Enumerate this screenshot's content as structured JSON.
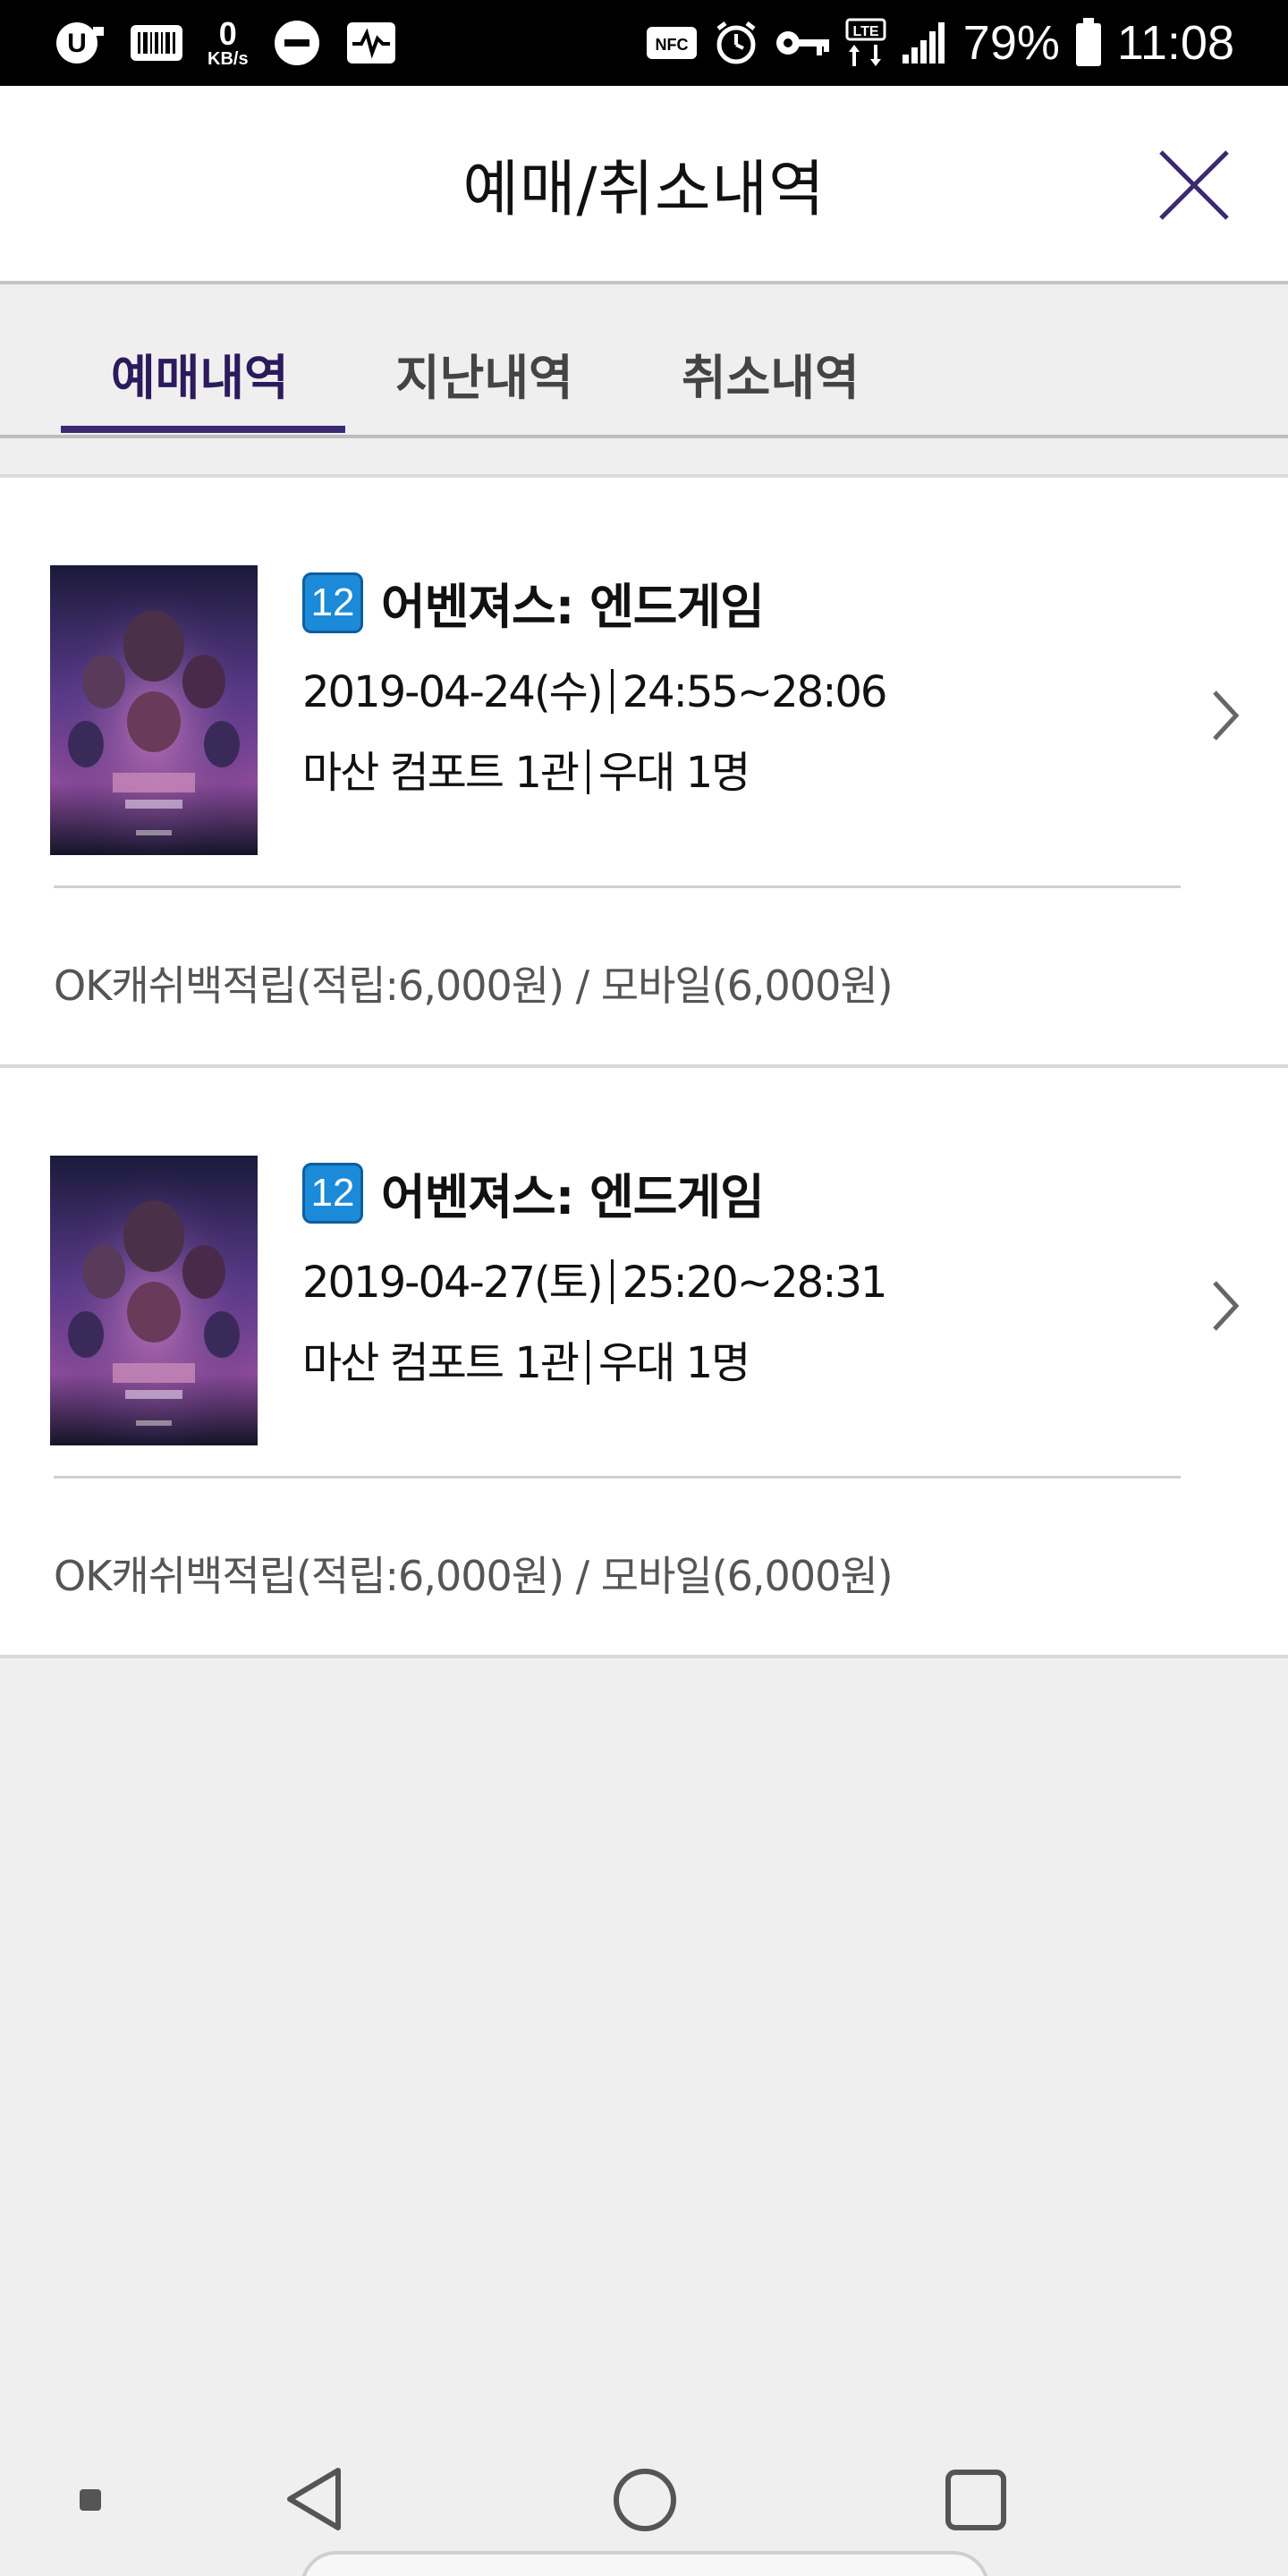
{
  "status_bar": {
    "speed_value": "0",
    "speed_unit": "KB/s",
    "nfc_label": "NFC",
    "lte_label": "LTE",
    "battery_text": "79%",
    "time": "11:08"
  },
  "header": {
    "title": "예매/취소내역"
  },
  "tabs": [
    {
      "label": "예매내역",
      "active": true
    },
    {
      "label": "지난내역",
      "active": false
    },
    {
      "label": "취소내역",
      "active": false
    }
  ],
  "bookings": [
    {
      "age_rating": "12",
      "title": "어벤져스: 엔드게임",
      "date": "2019-04-24(수)",
      "time": "24:55~28:06",
      "theater": "마산 컴포트 1관",
      "audience": "우대 1명",
      "payment": "OK캐쉬백적립(적립:6,000원) / 모바일(6,000원)"
    },
    {
      "age_rating": "12",
      "title": "어벤져스: 엔드게임",
      "date": "2019-04-27(토)",
      "time": "25:20~28:31",
      "theater": "마산 컴포트 1관",
      "audience": "우대 1명",
      "payment": "OK캐쉬백적립(적립:6,000원) / 모바일(6,000원)"
    }
  ],
  "colors": {
    "accent": "#3b2a72",
    "age_badge": "#1b8ad9",
    "background": "#efefef"
  },
  "icons": {
    "close": "close-icon",
    "chevron": "chevron-right-icon",
    "nav_back": "back-icon",
    "nav_home": "home-icon",
    "nav_recents": "recents-icon"
  }
}
